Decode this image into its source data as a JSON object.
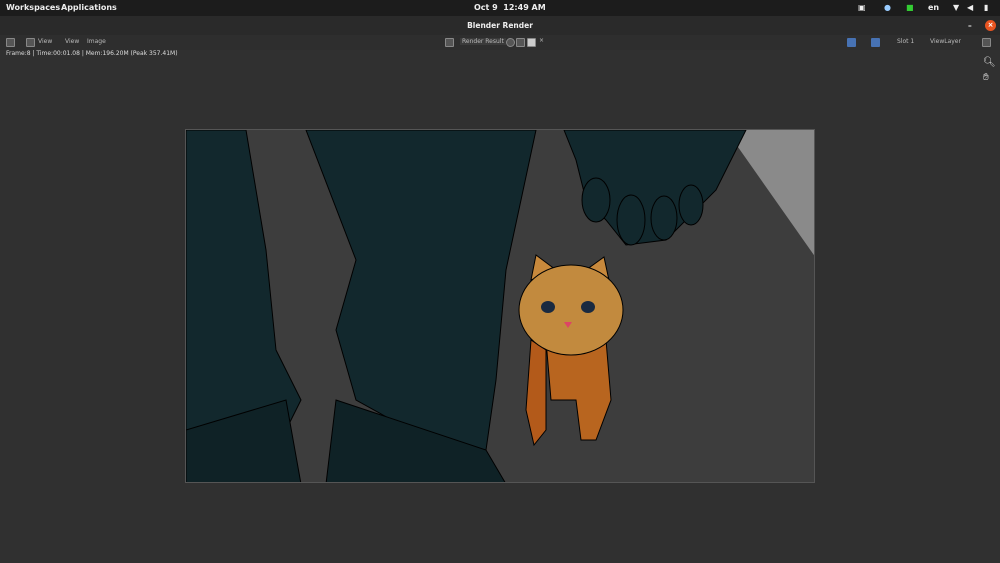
{
  "topbar": {
    "workspaces": "Workspaces",
    "applications": "Applications",
    "date": "Oct 9",
    "time": "12:49 AM",
    "lang": "en"
  },
  "window": {
    "title": "Blender Render"
  },
  "header": {
    "view_menu": "View",
    "view": "View",
    "image": "Image",
    "image_name": "Render Result",
    "slot": "Slot 1",
    "view_layer": "ViewLayer"
  },
  "status": {
    "text": "Frame:8 | Time:00:01.08 | Mem:196.20M (Peak 357.41M)"
  },
  "colors": {
    "accent": "#4772b3",
    "close": "#e95420"
  }
}
